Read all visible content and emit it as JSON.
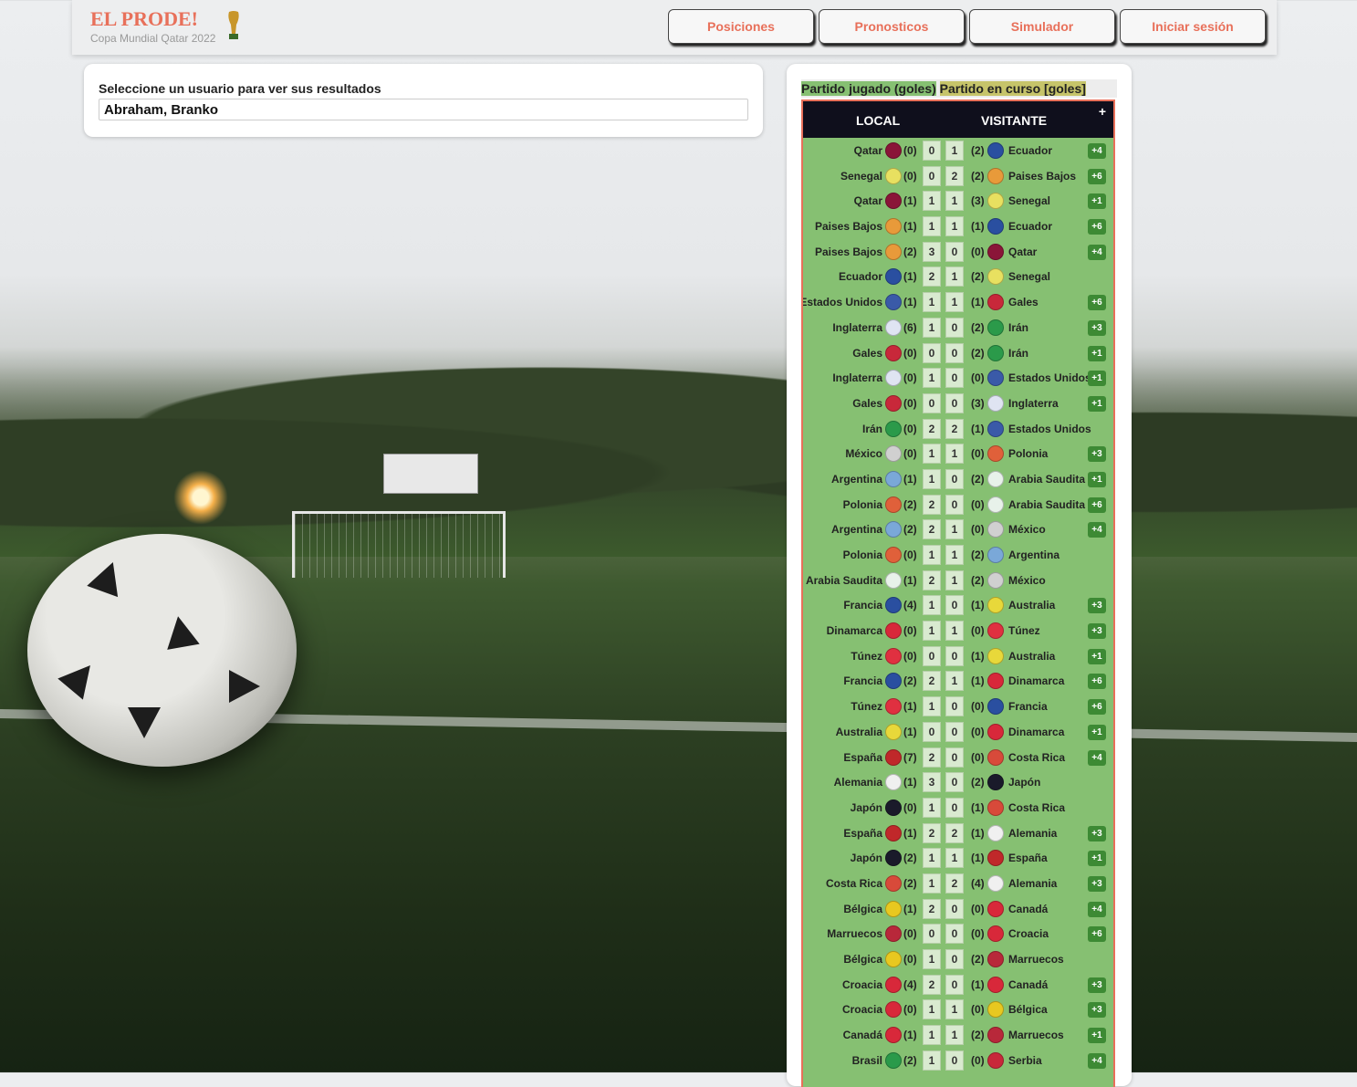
{
  "brand": {
    "title": "EL PRODE!",
    "subtitle": "Copa Mundial Qatar 2022"
  },
  "nav": [
    {
      "label": "Posiciones"
    },
    {
      "label": "Pronosticos"
    },
    {
      "label": "Simulador"
    },
    {
      "label": "Iniciar sesión"
    }
  ],
  "user_select": {
    "label": "Seleccione un usuario para ver sus resultados",
    "value": "Abraham, Branko"
  },
  "legend": {
    "played": "Partido jugado (goles)",
    "live": "Partido en curso [goles]"
  },
  "table": {
    "header_local": "LOCAL",
    "header_visitor": "VISITANTE",
    "header_plus": "+",
    "matches": [
      {
        "home": "Qatar",
        "hg": "(0)",
        "hp": "0",
        "ap": "1",
        "ag": "(2)",
        "away": "Ecuador",
        "pts": "+4",
        "hc": "#8a1538",
        "ac": "#2a4fa0"
      },
      {
        "home": "Senegal",
        "hg": "(0)",
        "hp": "0",
        "ap": "2",
        "ag": "(2)",
        "away": "Paises Bajos",
        "pts": "+6",
        "hc": "#e8e060",
        "ac": "#e89a3a"
      },
      {
        "home": "Qatar",
        "hg": "(1)",
        "hp": "1",
        "ap": "1",
        "ag": "(3)",
        "away": "Senegal",
        "pts": "+1",
        "hc": "#8a1538",
        "ac": "#e8e060"
      },
      {
        "home": "Paises Bajos",
        "hg": "(1)",
        "hp": "1",
        "ap": "1",
        "ag": "(1)",
        "away": "Ecuador",
        "pts": "+6",
        "hc": "#e89a3a",
        "ac": "#2a4fa0"
      },
      {
        "home": "Paises Bajos",
        "hg": "(2)",
        "hp": "3",
        "ap": "0",
        "ag": "(0)",
        "away": "Qatar",
        "pts": "+4",
        "hc": "#e89a3a",
        "ac": "#8a1538"
      },
      {
        "home": "Ecuador",
        "hg": "(1)",
        "hp": "2",
        "ap": "1",
        "ag": "(2)",
        "away": "Senegal",
        "pts": "",
        "hc": "#2a4fa0",
        "ac": "#e8e060"
      },
      {
        "home": "Estados Unidos",
        "hg": "(1)",
        "hp": "1",
        "ap": "1",
        "ag": "(1)",
        "away": "Gales",
        "pts": "+6",
        "hc": "#3a5aa8",
        "ac": "#c8283a"
      },
      {
        "home": "Inglaterra",
        "hg": "(6)",
        "hp": "1",
        "ap": "0",
        "ag": "(2)",
        "away": "Irán",
        "pts": "+3",
        "hc": "#dfe4f2",
        "ac": "#2b9a4a"
      },
      {
        "home": "Gales",
        "hg": "(0)",
        "hp": "0",
        "ap": "0",
        "ag": "(2)",
        "away": "Irán",
        "pts": "+1",
        "hc": "#c8283a",
        "ac": "#2b9a4a"
      },
      {
        "home": "Inglaterra",
        "hg": "(0)",
        "hp": "1",
        "ap": "0",
        "ag": "(0)",
        "away": "Estados Unidos",
        "pts": "+1",
        "hc": "#dfe4f2",
        "ac": "#3a5aa8"
      },
      {
        "home": "Gales",
        "hg": "(0)",
        "hp": "0",
        "ap": "0",
        "ag": "(3)",
        "away": "Inglaterra",
        "pts": "+1",
        "hc": "#c8283a",
        "ac": "#dfe4f2"
      },
      {
        "home": "Irán",
        "hg": "(0)",
        "hp": "2",
        "ap": "2",
        "ag": "(1)",
        "away": "Estados Unidos",
        "pts": "",
        "hc": "#2b9a4a",
        "ac": "#3a5aa8"
      },
      {
        "home": "México",
        "hg": "(0)",
        "hp": "1",
        "ap": "1",
        "ag": "(0)",
        "away": "Polonia",
        "pts": "+3",
        "hc": "#d0d0d0",
        "ac": "#e0603a"
      },
      {
        "home": "Argentina",
        "hg": "(1)",
        "hp": "1",
        "ap": "0",
        "ag": "(2)",
        "away": "Arabia Saudita",
        "pts": "+1",
        "hc": "#7aa8d8",
        "ac": "#e8f2ea"
      },
      {
        "home": "Polonia",
        "hg": "(2)",
        "hp": "2",
        "ap": "0",
        "ag": "(0)",
        "away": "Arabia Saudita",
        "pts": "+6",
        "hc": "#e0603a",
        "ac": "#e8f2ea"
      },
      {
        "home": "Argentina",
        "hg": "(2)",
        "hp": "2",
        "ap": "1",
        "ag": "(0)",
        "away": "México",
        "pts": "+4",
        "hc": "#7aa8d8",
        "ac": "#d0d0d0"
      },
      {
        "home": "Polonia",
        "hg": "(0)",
        "hp": "1",
        "ap": "1",
        "ag": "(2)",
        "away": "Argentina",
        "pts": "",
        "hc": "#e0603a",
        "ac": "#7aa8d8"
      },
      {
        "home": "Arabia Saudita",
        "hg": "(1)",
        "hp": "2",
        "ap": "1",
        "ag": "(2)",
        "away": "México",
        "pts": "",
        "hc": "#e8f2ea",
        "ac": "#d0d0d0"
      },
      {
        "home": "Francia",
        "hg": "(4)",
        "hp": "1",
        "ap": "0",
        "ag": "(1)",
        "away": "Australia",
        "pts": "+3",
        "hc": "#2a4fa0",
        "ac": "#e8d83a"
      },
      {
        "home": "Dinamarca",
        "hg": "(0)",
        "hp": "1",
        "ap": "1",
        "ag": "(0)",
        "away": "Túnez",
        "pts": "+3",
        "hc": "#d8283a",
        "ac": "#e03040"
      },
      {
        "home": "Túnez",
        "hg": "(0)",
        "hp": "0",
        "ap": "0",
        "ag": "(1)",
        "away": "Australia",
        "pts": "+1",
        "hc": "#e03040",
        "ac": "#e8d83a"
      },
      {
        "home": "Francia",
        "hg": "(2)",
        "hp": "2",
        "ap": "1",
        "ag": "(1)",
        "away": "Dinamarca",
        "pts": "+6",
        "hc": "#2a4fa0",
        "ac": "#d8283a"
      },
      {
        "home": "Túnez",
        "hg": "(1)",
        "hp": "1",
        "ap": "0",
        "ag": "(0)",
        "away": "Francia",
        "pts": "+6",
        "hc": "#e03040",
        "ac": "#2a4fa0"
      },
      {
        "home": "Australia",
        "hg": "(1)",
        "hp": "0",
        "ap": "0",
        "ag": "(0)",
        "away": "Dinamarca",
        "pts": "+1",
        "hc": "#e8d83a",
        "ac": "#d8283a"
      },
      {
        "home": "España",
        "hg": "(7)",
        "hp": "2",
        "ap": "0",
        "ag": "(0)",
        "away": "Costa Rica",
        "pts": "+4",
        "hc": "#c0282a",
        "ac": "#d84a3a"
      },
      {
        "home": "Alemania",
        "hg": "(1)",
        "hp": "3",
        "ap": "0",
        "ag": "(2)",
        "away": "Japón",
        "pts": "",
        "hc": "#f0f0f0",
        "ac": "#1a1a2a"
      },
      {
        "home": "Japón",
        "hg": "(0)",
        "hp": "1",
        "ap": "0",
        "ag": "(1)",
        "away": "Costa Rica",
        "pts": "",
        "hc": "#1a1a2a",
        "ac": "#d84a3a"
      },
      {
        "home": "España",
        "hg": "(1)",
        "hp": "2",
        "ap": "2",
        "ag": "(1)",
        "away": "Alemania",
        "pts": "+3",
        "hc": "#c0282a",
        "ac": "#f0f0f0"
      },
      {
        "home": "Japón",
        "hg": "(2)",
        "hp": "1",
        "ap": "1",
        "ag": "(1)",
        "away": "España",
        "pts": "+1",
        "hc": "#1a1a2a",
        "ac": "#c0282a"
      },
      {
        "home": "Costa Rica",
        "hg": "(2)",
        "hp": "1",
        "ap": "2",
        "ag": "(4)",
        "away": "Alemania",
        "pts": "+3",
        "hc": "#d84a3a",
        "ac": "#f0f0f0"
      },
      {
        "home": "Bélgica",
        "hg": "(1)",
        "hp": "2",
        "ap": "0",
        "ag": "(0)",
        "away": "Canadá",
        "pts": "+4",
        "hc": "#e8c820",
        "ac": "#d8283a"
      },
      {
        "home": "Marruecos",
        "hg": "(0)",
        "hp": "0",
        "ap": "0",
        "ag": "(0)",
        "away": "Croacia",
        "pts": "+6",
        "hc": "#b8283a",
        "ac": "#d8283a"
      },
      {
        "home": "Bélgica",
        "hg": "(0)",
        "hp": "1",
        "ap": "0",
        "ag": "(2)",
        "away": "Marruecos",
        "pts": "",
        "hc": "#e8c820",
        "ac": "#b8283a"
      },
      {
        "home": "Croacia",
        "hg": "(4)",
        "hp": "2",
        "ap": "0",
        "ag": "(1)",
        "away": "Canadá",
        "pts": "+3",
        "hc": "#d8283a",
        "ac": "#d8283a"
      },
      {
        "home": "Croacia",
        "hg": "(0)",
        "hp": "1",
        "ap": "1",
        "ag": "(0)",
        "away": "Bélgica",
        "pts": "+3",
        "hc": "#d8283a",
        "ac": "#e8c820"
      },
      {
        "home": "Canadá",
        "hg": "(1)",
        "hp": "1",
        "ap": "1",
        "ag": "(2)",
        "away": "Marruecos",
        "pts": "+1",
        "hc": "#d8283a",
        "ac": "#b8283a"
      },
      {
        "home": "Brasil",
        "hg": "(2)",
        "hp": "1",
        "ap": "0",
        "ag": "(0)",
        "away": "Serbia",
        "pts": "+4",
        "hc": "#2a9a4a",
        "ac": "#c8283a"
      }
    ]
  }
}
